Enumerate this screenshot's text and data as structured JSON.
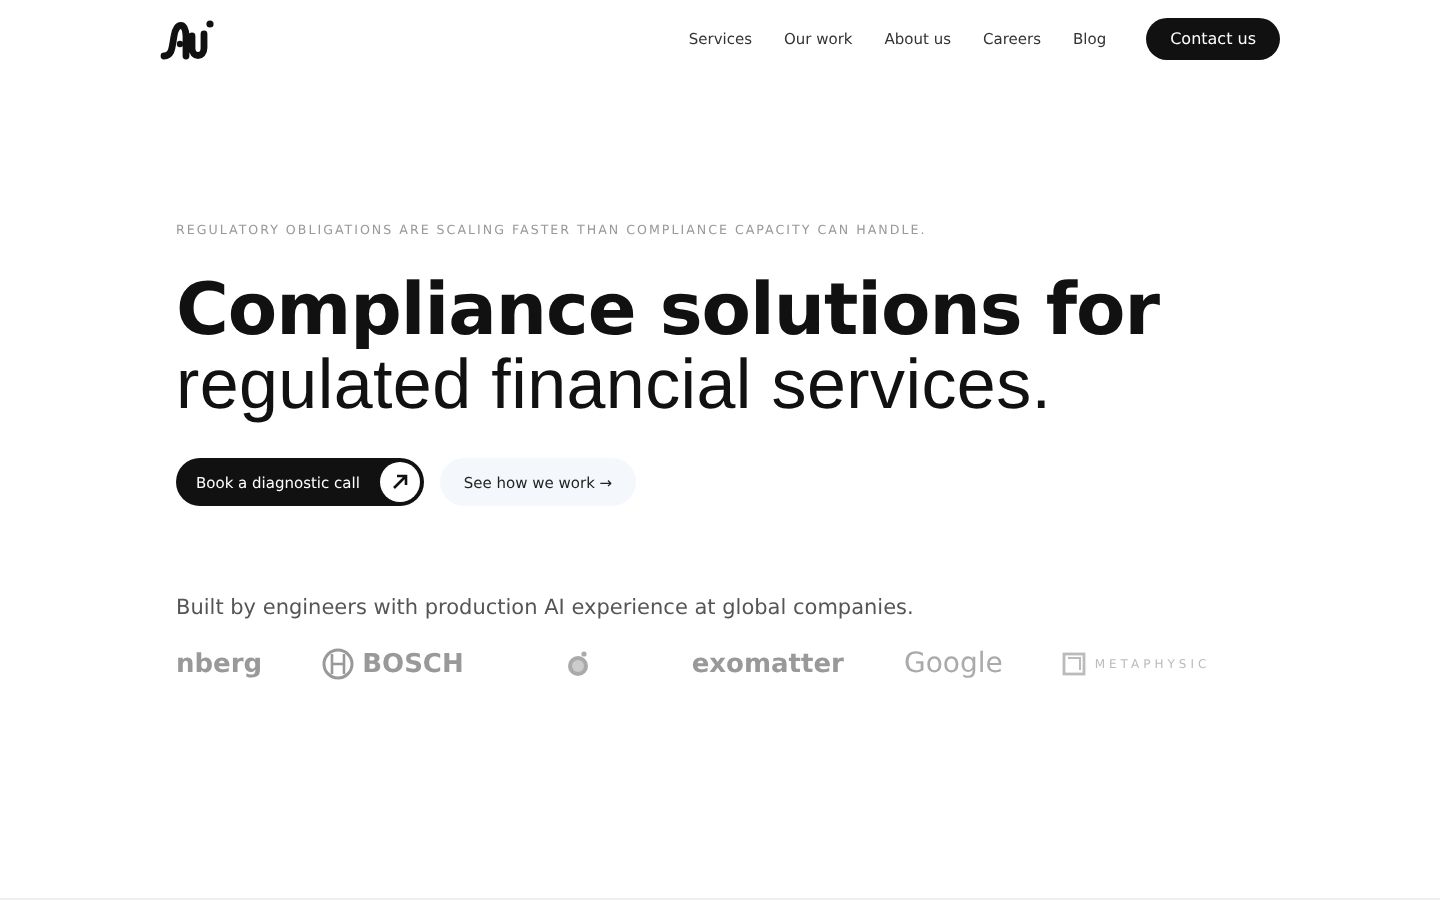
{
  "nav": {
    "links": [
      "Services",
      "Our work",
      "About us",
      "Careers",
      "Blog"
    ],
    "cta": "Contact us"
  },
  "hero": {
    "eyebrow": "REGULATORY OBLIGATIONS ARE SCALING FASTER THAN COMPLIANCE CAPACITY CAN HANDLE.",
    "title_line_1": "Compliance solutions for",
    "title_line_2": "regulated financial services.",
    "primary_button": "Book a diagnostic call",
    "secondary_button": "See how we work →"
  },
  "logos": {
    "caption": "Built by engineers with production AI experience at global companies.",
    "items": [
      {
        "kind": "wordmark",
        "text": "nberg"
      },
      {
        "kind": "emblem",
        "text": "BOSCH"
      },
      {
        "kind": "mark"
      },
      {
        "kind": "wordmark",
        "text": "exomatter"
      },
      {
        "kind": "light",
        "text": "Google"
      },
      {
        "kind": "boxed",
        "text": "METAPHYSIC"
      }
    ]
  }
}
